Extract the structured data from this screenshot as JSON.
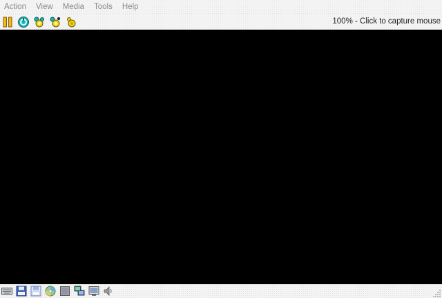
{
  "menu": {
    "items": [
      {
        "label": "Action"
      },
      {
        "label": "View"
      },
      {
        "label": "Media"
      },
      {
        "label": "Tools"
      },
      {
        "label": "Help"
      }
    ]
  },
  "toolbar": {
    "buttons": [
      {
        "icon": "pause-icon"
      },
      {
        "icon": "reset-icon"
      },
      {
        "icon": "ctrl-alt-del-icon"
      },
      {
        "icon": "send-keys-icon"
      },
      {
        "icon": "snapshot-icon"
      }
    ],
    "status_text": "100% - Click to capture mouse"
  },
  "statusbar": {
    "icons": [
      "keyboard-icon",
      "floppy-drive-icon",
      "floppy-disk-icon",
      "cd-drive-icon",
      "hard-disk-icon",
      "network-icon",
      "display-icon",
      "sound-icon"
    ]
  },
  "colors": {
    "screen": "#000000",
    "menu_text": "#8a8a8a",
    "status_text": "#222222",
    "accent_yellow": "#f2d21b",
    "accent_teal": "#17a6a6"
  }
}
